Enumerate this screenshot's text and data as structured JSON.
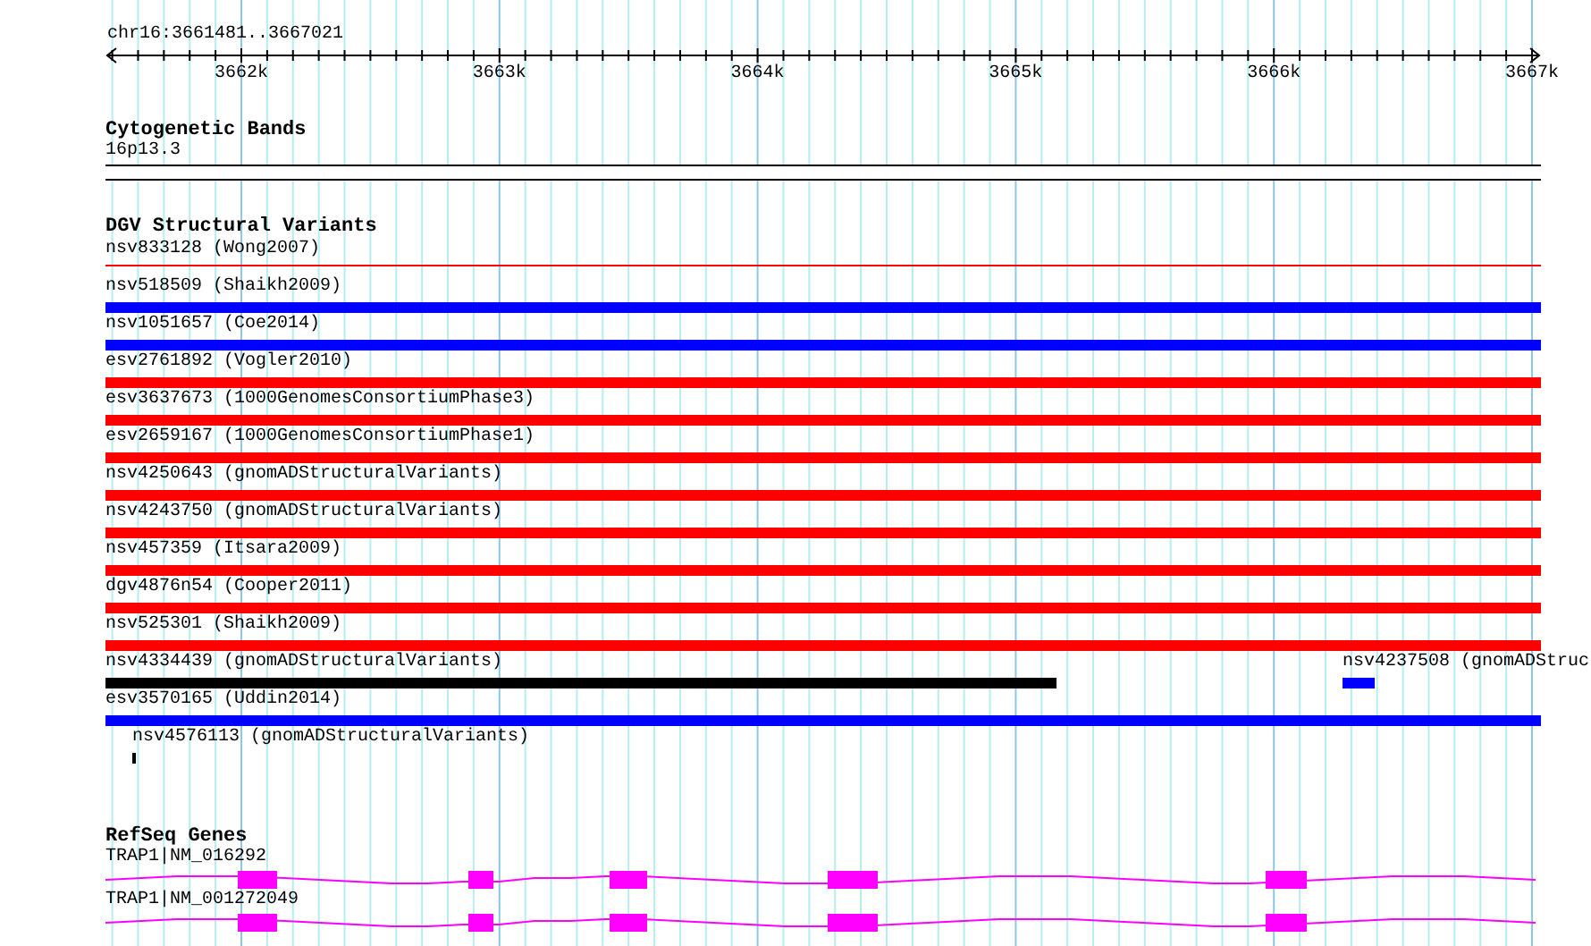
{
  "ruler": {
    "range": "chr16:3661481..3667021",
    "tick_labels": [
      "3662k",
      "3663k",
      "3664k",
      "3665k",
      "3666k",
      "3667k"
    ]
  },
  "cytoband_track": {
    "title": "Cytogenetic Bands",
    "band": "16p13.3"
  },
  "dgv_track": {
    "title": "DGV Structural Variants",
    "rows": [
      {
        "features": [
          {
            "label": "nsv833128 (Wong2007)",
            "color": "#ff0000",
            "kind": "line"
          }
        ]
      },
      {
        "features": [
          {
            "label": "nsv518509 (Shaikh2009)",
            "color": "#0000ff",
            "kind": "bar"
          }
        ]
      },
      {
        "features": [
          {
            "label": "nsv1051657 (Coe2014)",
            "color": "#0000ff",
            "kind": "bar"
          }
        ]
      },
      {
        "features": [
          {
            "label": "esv2761892 (Vogler2010)",
            "color": "#ff0000",
            "kind": "bar"
          }
        ]
      },
      {
        "features": [
          {
            "label": "esv3637673 (1000GenomesConsortiumPhase3)",
            "color": "#ff0000",
            "kind": "bar"
          }
        ]
      },
      {
        "features": [
          {
            "label": "esv2659167 (1000GenomesConsortiumPhase1)",
            "color": "#ff0000",
            "kind": "bar"
          }
        ]
      },
      {
        "features": [
          {
            "label": "nsv4250643 (gnomADStructuralVariants)",
            "color": "#ff0000",
            "kind": "bar"
          }
        ]
      },
      {
        "features": [
          {
            "label": "nsv4243750 (gnomADStructuralVariants)",
            "color": "#ff0000",
            "kind": "bar"
          }
        ]
      },
      {
        "features": [
          {
            "label": "nsv457359 (Itsara2009)",
            "color": "#ff0000",
            "kind": "bar"
          }
        ]
      },
      {
        "features": [
          {
            "label": "dgv4876n54 (Cooper2011)",
            "color": "#ff0000",
            "kind": "bar"
          }
        ]
      },
      {
        "features": [
          {
            "label": "nsv525301 (Shaikh2009)",
            "color": "#ff0000",
            "kind": "bar"
          }
        ]
      },
      {
        "features": [
          {
            "label": "nsv4334439 (gnomADStructuralVariants)",
            "color": "#000000",
            "kind": "bar"
          },
          {
            "label": "nsv4237508 (gnomADStruc",
            "color": "#0000ff",
            "kind": "bar"
          }
        ]
      },
      {
        "features": [
          {
            "label": "esv3570165 (Uddin2014)",
            "color": "#0000ff",
            "kind": "bar"
          }
        ]
      },
      {
        "features": [
          {
            "label": "nsv4576113 (gnomADStructuralVariants)",
            "color": "#000000",
            "kind": "tick"
          }
        ]
      }
    ]
  },
  "refseq_track": {
    "title": "RefSeq Genes",
    "genes": [
      {
        "label": "TRAP1|NM_016292"
      },
      {
        "label": "TRAP1|NM_001272049"
      }
    ]
  }
}
